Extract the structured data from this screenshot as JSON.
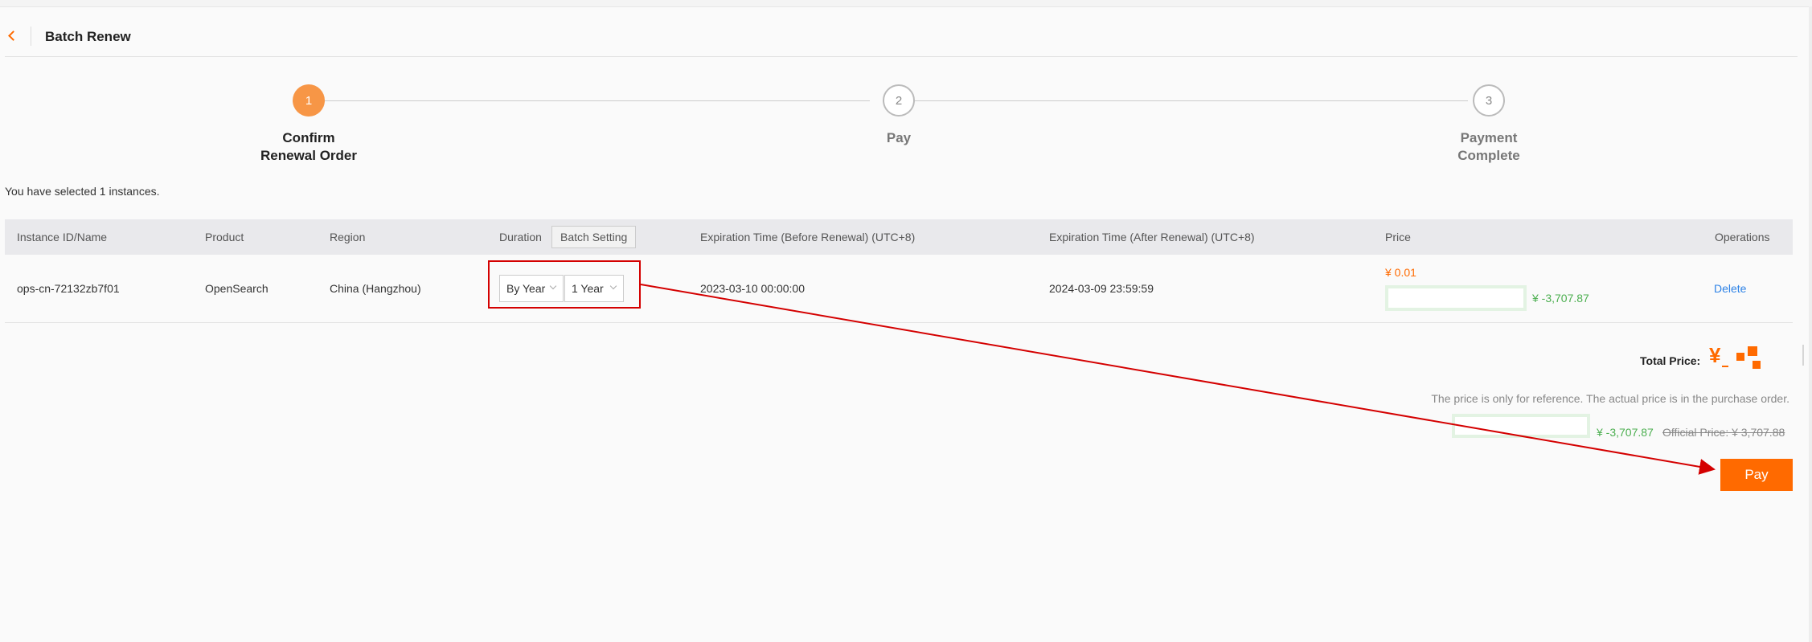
{
  "header": {
    "title": "Batch Renew"
  },
  "steps": [
    {
      "number": "1",
      "label_line1": "Confirm",
      "label_line2": "Renewal Order"
    },
    {
      "number": "2",
      "label_line1": "Pay",
      "label_line2": ""
    },
    {
      "number": "3",
      "label_line1": "Payment",
      "label_line2": "Complete"
    }
  ],
  "selection": {
    "text": "You have selected 1 instances."
  },
  "table": {
    "headers": {
      "instance": "Instance ID/Name",
      "product": "Product",
      "region": "Region",
      "duration": "Duration",
      "batch_setting": "Batch Setting",
      "exp_before": "Expiration Time (Before Renewal) (UTC+8)",
      "exp_after": "Expiration Time (After Renewal) (UTC+8)",
      "price": "Price",
      "operations": "Operations"
    },
    "rows": [
      {
        "instance": "ops-cn-72132zb7f01",
        "product": "OpenSearch",
        "region": "China (Hangzhou)",
        "billing_unit": "By Year",
        "period": "1 Year",
        "exp_before": "2023-03-10 00:00:00",
        "exp_after": "2024-03-09 23:59:59",
        "price": "¥ 0.01",
        "discount": "¥ -3,707.87",
        "operation": "Delete"
      }
    ]
  },
  "totals": {
    "label": "Total Price:",
    "currency": "¥",
    "reference_note": "The price is only for reference. The actual price is in the purchase order.",
    "discount": "¥ -3,707.87",
    "official_price": "Official Price: ¥ 3,707.88"
  },
  "actions": {
    "pay": "Pay"
  },
  "colors": {
    "accent": "#ff6a00",
    "step_active": "#f79646",
    "link": "#2d82e6",
    "discount": "#4caf50",
    "annotation": "#d40000"
  }
}
